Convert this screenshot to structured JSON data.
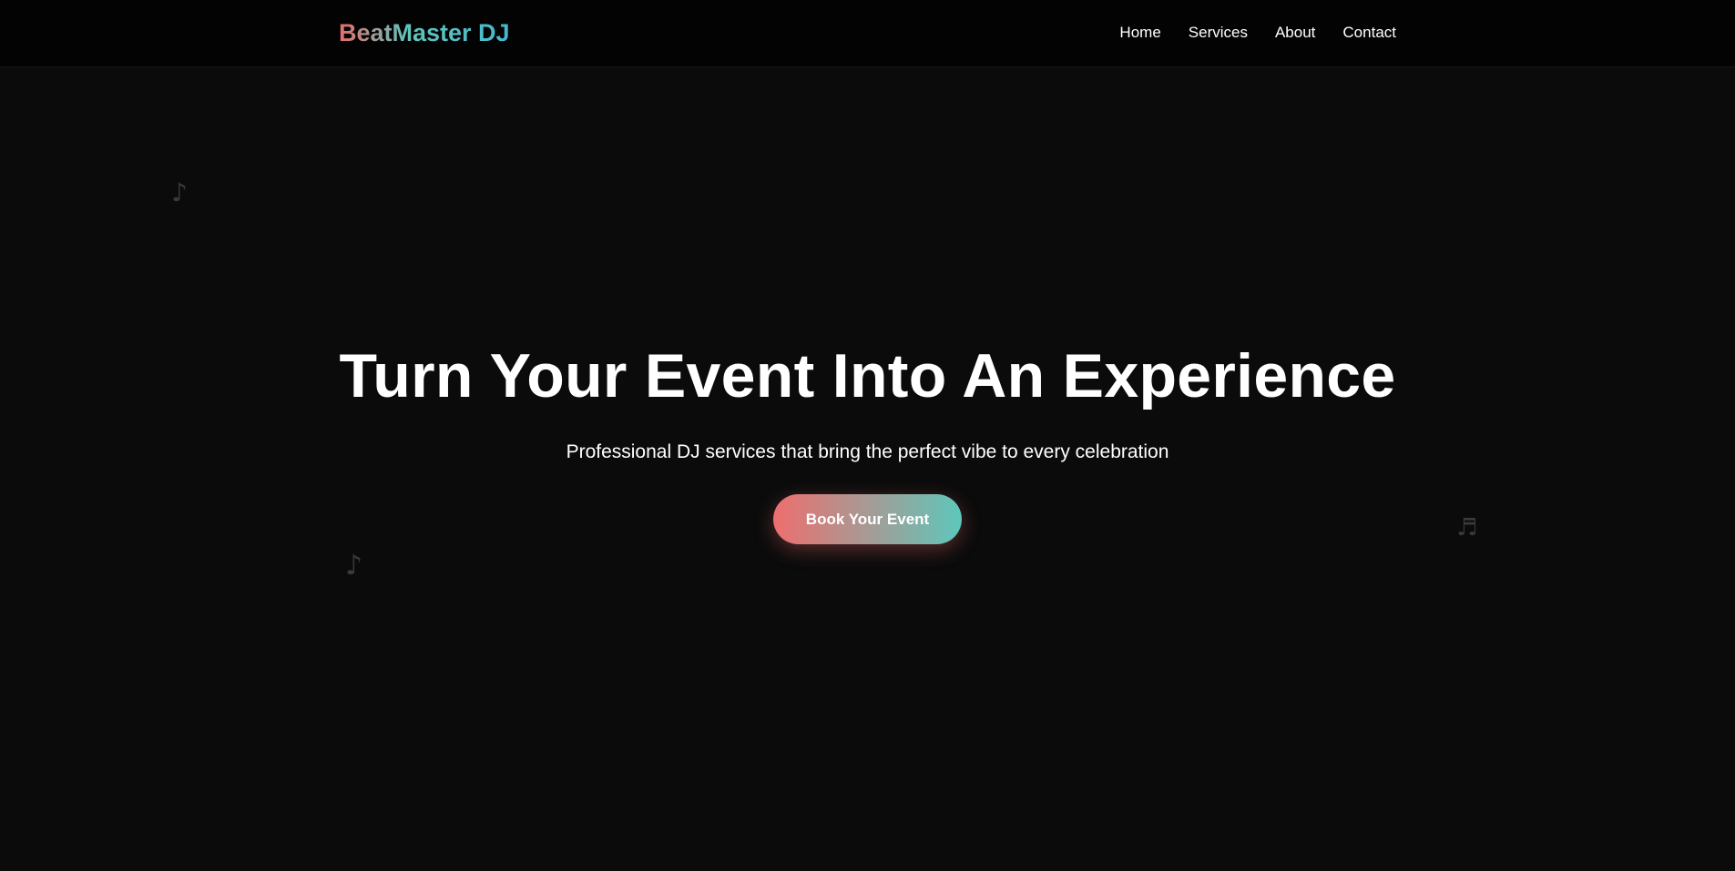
{
  "header": {
    "logo": "BeatMaster DJ",
    "nav": [
      {
        "label": "Home"
      },
      {
        "label": "Services"
      },
      {
        "label": "About"
      },
      {
        "label": "Contact"
      }
    ]
  },
  "hero": {
    "title": "Turn Your Event Into An Experience",
    "subtitle": "Professional DJ services that bring the perfect vibe to every celebration",
    "cta_label": "Book Your Event",
    "decorations": [
      {
        "icon": "music-note-icon",
        "glyph": "♪"
      },
      {
        "icon": "music-note-icon",
        "glyph": "♪"
      },
      {
        "icon": "music-notes-icon",
        "glyph": "♬"
      }
    ]
  },
  "colors": {
    "background": "#0b0b0b",
    "navbar": "#030303",
    "accent_start": "#ee6e6e",
    "accent_end": "#5ec7bb"
  }
}
